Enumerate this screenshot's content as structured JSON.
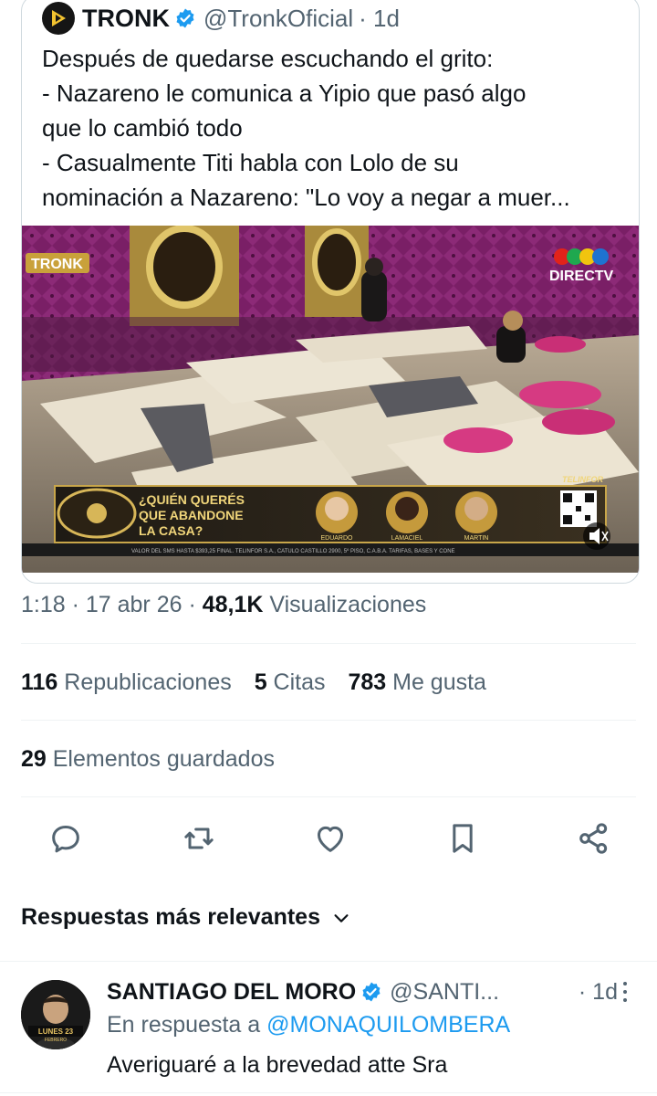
{
  "quoted_tweet": {
    "author_name": "TRONK",
    "handle": "@TronkOficial",
    "time": "· 1d",
    "text_lines": [
      "Después de quedarse escuchando el grito:",
      "- Nazareno le comunica a Yipio que pasó algo",
      "que lo cambió todo",
      "- Casualmente Titi habla con Lolo de su",
      "nominación a Nazareno: \"Lo voy a negar a muer..."
    ],
    "media": {
      "logo_left": "TRONK",
      "logo_right": "DIRECTV",
      "banner_question_l1": "¿QUIÉN QUERÉS",
      "banner_question_l2": "QUE ABANDONE",
      "banner_question_l3": "LA CASA?",
      "candidates": [
        "EDUARDO",
        "LAMACIEL",
        "MARTIN"
      ],
      "sponsor": "TELINFOR",
      "ticker": "VALOR DEL SMS HASTA $393,25 FINAL. TELINFOR S.A., CATULO CASTILLO 2900, 5º PISO, C.A.B.A. TARIFAS, BASES Y CONE"
    }
  },
  "meta": {
    "time": "1:18 · 17 abr 26 · ",
    "views_count": "48,1K",
    "views_label": " Visualizaciones"
  },
  "stats": {
    "reposts_count": "116",
    "reposts_label": " Republicaciones",
    "quotes_count": "5",
    "quotes_label": " Citas",
    "likes_count": "783",
    "likes_label": " Me gusta",
    "bookmarks_count": "29",
    "bookmarks_label": " Elementos guardados"
  },
  "actions": [
    "reply-icon",
    "repost-icon",
    "like-icon",
    "bookmark-icon",
    "share-icon"
  ],
  "sort": {
    "label": "Respuestas más relevantes"
  },
  "reply": {
    "author_name": "SANTIAGO DEL MORO",
    "handle": "@SANTI...",
    "time": "· 1d",
    "in_reply_prefix": "En respuesta a ",
    "in_reply_handle": "@MONAQUILOMBERA",
    "text": "Averiguaré a la brevedad atte Sra",
    "avatar_text_l1": "LUNES 23",
    "avatar_text_l2": "FEBRERO"
  },
  "colors": {
    "verified": "#1d9bf0",
    "link": "#1d9bf0",
    "secondary": "#536471",
    "accent_magenta": "#7d1d6c",
    "gold": "#c8a64a"
  }
}
